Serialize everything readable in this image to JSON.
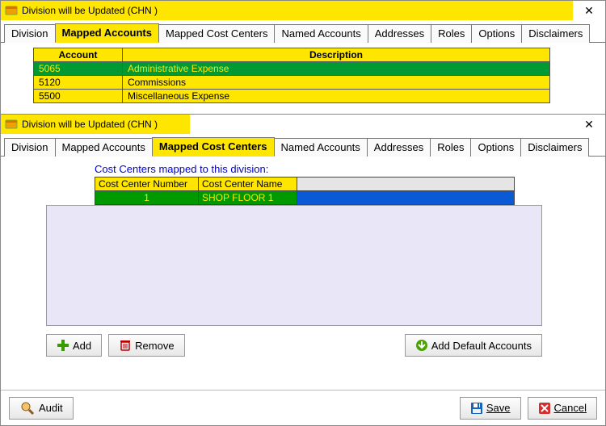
{
  "backWindow": {
    "title": "Division will be Updated  (CHN   )",
    "tabs": [
      "Division",
      "Mapped Accounts",
      "Mapped Cost Centers",
      "Named Accounts",
      "Addresses",
      "Roles",
      "Options",
      "Disclaimers"
    ],
    "activeTab": "Mapped Accounts",
    "grid": {
      "headers": [
        "Account",
        "Description"
      ],
      "rows": [
        {
          "acct": "5065",
          "desc": "Administrative Expense",
          "selected": true
        },
        {
          "acct": "5120",
          "desc": "Commissions",
          "selected": false
        },
        {
          "acct": "5500",
          "desc": "Miscellaneous Expense",
          "selected": false
        }
      ]
    }
  },
  "frontWindow": {
    "title": "Division will be Updated  (CHN   )",
    "tabs": [
      "Division",
      "Mapped Accounts",
      "Mapped Cost Centers",
      "Named Accounts",
      "Addresses",
      "Roles",
      "Options",
      "Disclaimers"
    ],
    "activeTab": "Mapped Cost Centers",
    "caption": "Cost Centers mapped to this division:",
    "headers": [
      "Cost Center Number",
      "Cost Center Name"
    ],
    "rows": [
      {
        "num": "1",
        "name": "SHOP FLOOR 1"
      }
    ],
    "buttons": {
      "add": "Add",
      "remove": "Remove",
      "addDefault": "Add Default Accounts"
    }
  },
  "bottom": {
    "audit": "Audit",
    "save": "Save",
    "cancel": "Cancel"
  }
}
